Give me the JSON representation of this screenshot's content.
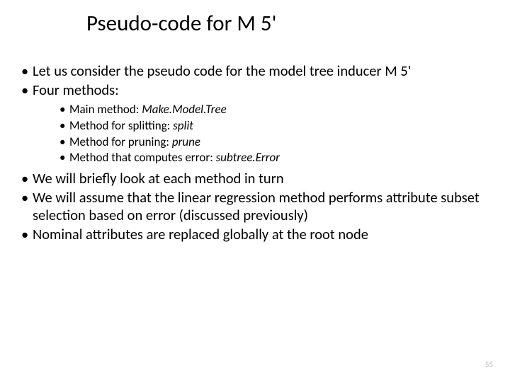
{
  "title": "Pseudo-code for M 5'",
  "bullets": {
    "b1": "Let us consider the pseudo code for the model tree inducer M 5'",
    "b2": "Four methods:",
    "b3": "We will briefly look at each method in turn",
    "b4": "We will assume that the linear regression method performs attribute subset selection based on error (discussed previously)",
    "b5": "Nominal attributes are replaced globally at the root node"
  },
  "methods": {
    "m1_pre": "Main method: ",
    "m1_it": "Make.Model.Tree",
    "m2_pre": "Method for splitting: ",
    "m2_it": "split",
    "m3_pre": "Method for pruning: ",
    "m3_it": "prune",
    "m4_pre": "Method that computes error: ",
    "m4_it": "subtree.Error"
  },
  "page_number": "55"
}
